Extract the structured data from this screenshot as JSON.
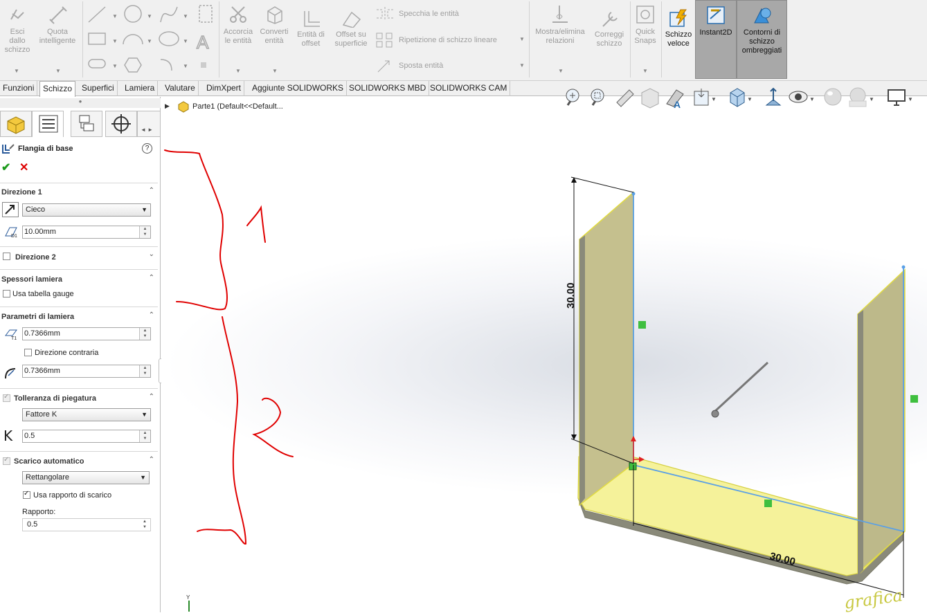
{
  "ribbon": {
    "exit_sketch": "Esci dallo schizzo",
    "smart_dim": "Quota intelligente",
    "trim": "Accorcia le entità",
    "convert": "Converti entità",
    "offset_entities": "Entità di offset",
    "offset_surface": "Offset su superficie",
    "mirror": "Specchia le entità",
    "linear_pattern": "Ripetizione di schizzo lineare",
    "move": "Sposta entità",
    "relations": "Mostra/elimina relazioni",
    "repair": "Correggi schizzo",
    "quick_snaps": "Quick Snaps",
    "rapid_sketch": "Schizzo veloce",
    "instant2d": "Instant2D",
    "shaded_contours": "Contorni di schizzo ombreggiati"
  },
  "tabs": [
    "Funzioni",
    "Schizzo",
    "Superfici",
    "Lamiera",
    "Valutare",
    "DimXpert",
    "Aggiunte SOLIDWORKS",
    "SOLIDWORKS MBD",
    "SOLIDWORKS CAM"
  ],
  "active_tab": "Schizzo",
  "tree": {
    "item": "Parte1  (Default<<Default..."
  },
  "pm": {
    "title": "Flangia di base",
    "dir1": {
      "header": "Direzione 1",
      "type": "Cieco",
      "depth": "10.00mm"
    },
    "dir2": {
      "header": "Direzione 2"
    },
    "thick": {
      "header": "Spessori lamiera",
      "gauge": "Usa tabella gauge"
    },
    "params": {
      "header": "Parametri di lamiera",
      "t": "0.7366mm",
      "reverse": "Direzione contraria",
      "r": "0.7366mm"
    },
    "bend": {
      "header": "Tolleranza di piegatura",
      "type": "Fattore K",
      "k": "0.5"
    },
    "relief": {
      "header": "Scarico automatico",
      "type": "Rettangolare",
      "use_ratio": "Usa rapporto di scarico",
      "ratio_label": "Rapporto:",
      "ratio": "0.5"
    }
  },
  "annotations": {
    "one": "1",
    "two": "2"
  },
  "dims": {
    "height": "30.00",
    "width": "30.00"
  },
  "watermark": "grafica",
  "colors": {
    "accent": "#0078d4",
    "sheet": "#f2ef7a",
    "edge": "#5aa0e6",
    "annot": "#e00000"
  }
}
